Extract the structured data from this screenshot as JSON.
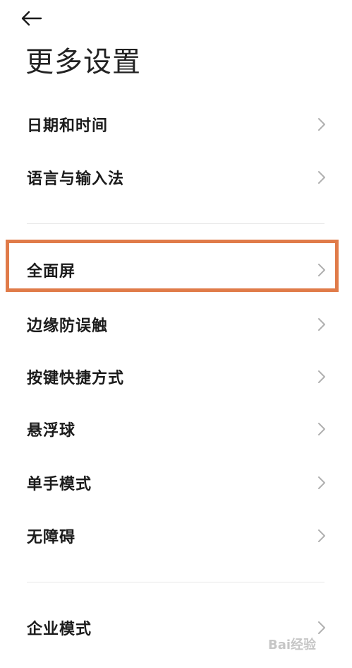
{
  "header": {
    "back_icon": "arrow-left-icon",
    "title": "更多设置"
  },
  "colors": {
    "highlight": "#e07b49",
    "chevron": "#b0b0b0",
    "divider": "#e6e6e6"
  },
  "sections": [
    {
      "items": [
        {
          "label": "日期和时间",
          "icon": "chevron-right-icon"
        },
        {
          "label": "语言与输入法",
          "icon": "chevron-right-icon"
        }
      ]
    },
    {
      "items": [
        {
          "label": "全面屏",
          "icon": "chevron-right-icon",
          "highlighted": true
        },
        {
          "label": "边缘防误触",
          "icon": "chevron-right-icon"
        },
        {
          "label": "按键快捷方式",
          "icon": "chevron-right-icon"
        },
        {
          "label": "悬浮球",
          "icon": "chevron-right-icon"
        },
        {
          "label": "单手模式",
          "icon": "chevron-right-icon"
        },
        {
          "label": "无障碍",
          "icon": "chevron-right-icon"
        }
      ]
    },
    {
      "items": [
        {
          "label": "企业模式",
          "icon": "chevron-right-icon"
        }
      ]
    }
  ],
  "watermark": {
    "text": "Bai经验",
    "icon": "baidu-paw-icon"
  }
}
